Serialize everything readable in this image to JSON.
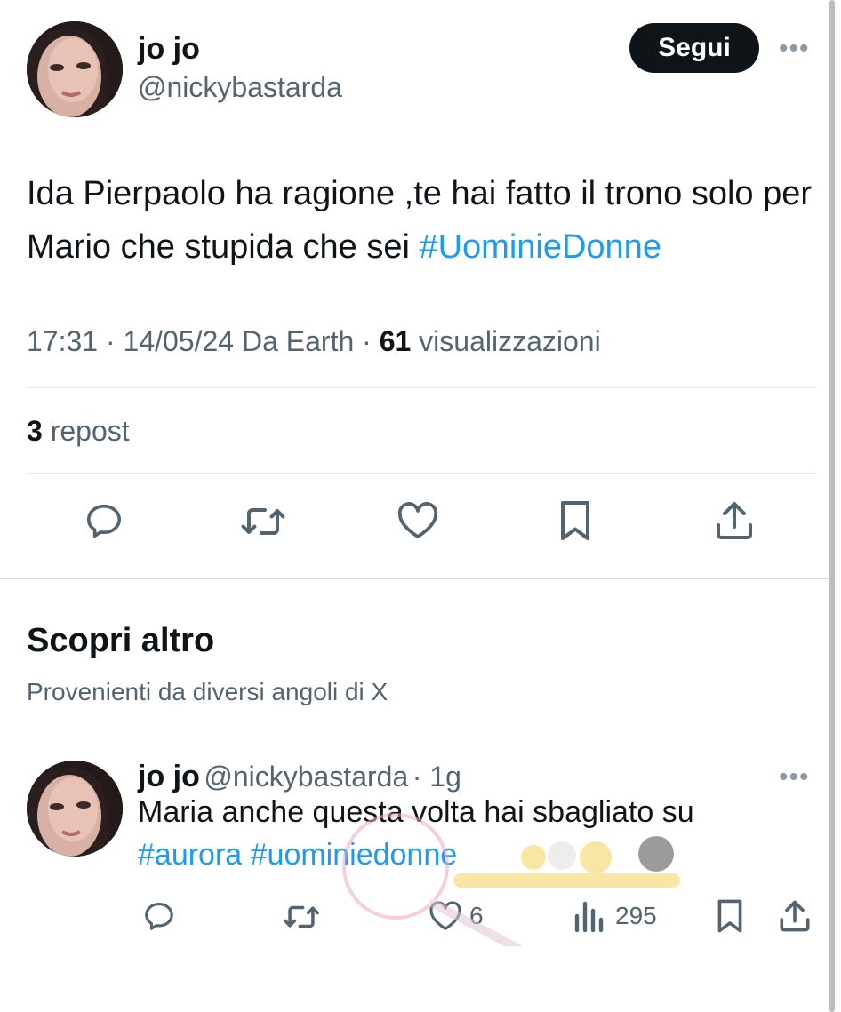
{
  "tweet": {
    "author_name": "jo jo",
    "author_handle": "@nickybastarda",
    "follow_label": "Segui",
    "more": "•••",
    "text_plain": "Ida Pierpaolo ha ragione ,te hai fatto il trono solo per Mario che stupida che sei ",
    "hashtag": "#UominieDonne",
    "time": "17:31",
    "date": "14/05/24",
    "source": "Da Earth",
    "views_count": "61",
    "views_label": "visualizzazioni",
    "repost_count": "3",
    "repost_label": "repost",
    "sep": "·"
  },
  "discover": {
    "title": "Scopri altro",
    "subtitle": "Provenienti da diversi angoli di X"
  },
  "reply": {
    "author_name": "jo jo",
    "author_handle": "@nickybastarda",
    "time_ago": "· 1g",
    "more": "•••",
    "text": "Maria anche questa volta hai sbagliato su",
    "hashtags": "#aurora #uominiedonne",
    "likes": "6",
    "views": "295"
  },
  "icons": [
    "reply-icon",
    "repost-icon",
    "like-icon",
    "bookmark-icon",
    "share-icon",
    "views-icon",
    "more-icon"
  ],
  "colors": {
    "text": "#0f1419",
    "secondary": "#536471",
    "link": "#1d9bf0",
    "button": "#0f1419"
  }
}
